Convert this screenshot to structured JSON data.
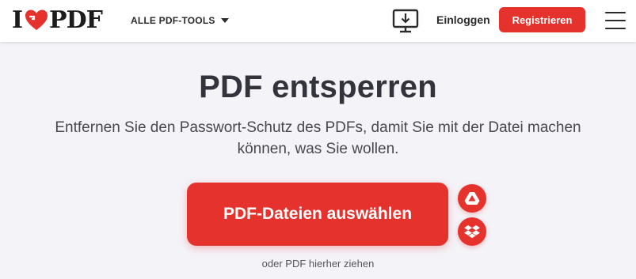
{
  "header": {
    "logo": {
      "letter": "I",
      "suffix": "PDF",
      "heart_color": "#e5322d"
    },
    "tools_menu_label": "ALLE PDF-TOOLS",
    "desktop_icon": "desktop-download-icon",
    "login_label": "Einloggen",
    "register_label": "Registrieren",
    "menu_icon": "hamburger-menu-icon"
  },
  "main": {
    "title": "PDF entsperren",
    "subtitle": "Entfernen Sie den Passwort-Schutz des PDFs, damit Sie mit der Datei machen können, was Sie wollen.",
    "select_button_label": "PDF-Dateien auswählen",
    "gdrive_icon": "google-drive-icon",
    "dropbox_icon": "dropbox-icon",
    "drop_hint": "oder PDF hierher ziehen"
  },
  "colors": {
    "accent": "#e5322d",
    "background": "#f4f3f8",
    "header": "#ffffff"
  }
}
